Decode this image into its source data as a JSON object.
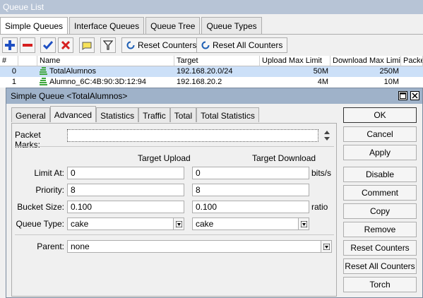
{
  "queue_list": {
    "title": "Queue List",
    "tabs": [
      "Simple Queues",
      "Interface Queues",
      "Queue Tree",
      "Queue Types"
    ],
    "toolbar": {
      "reset_counters": "Reset Counters",
      "reset_all_counters": "Reset All Counters"
    },
    "table": {
      "columns": [
        "#",
        "Name",
        "Target",
        "Upload Max Limit",
        "Download Max Limit",
        "Packe"
      ],
      "rows": [
        {
          "num": "0",
          "name": "TotalAlumnos",
          "target": "192.168.20.0/24",
          "upload": "50M",
          "download": "250M"
        },
        {
          "num": "1",
          "name": "Alumno_6C:4B:90:3D:12:94",
          "target": "192.168.20.2",
          "upload": "4M",
          "download": "10M"
        }
      ]
    }
  },
  "dialog": {
    "title": "Simple Queue <TotalAlumnos>",
    "tabs": [
      "General",
      "Advanced",
      "Statistics",
      "Traffic",
      "Total",
      "Total Statistics"
    ],
    "active_tab": "Advanced",
    "packet_marks_label": "Packet Marks:",
    "target_upload_label": "Target Upload",
    "target_download_label": "Target Download",
    "limit_at": {
      "label": "Limit At:",
      "upload": "0",
      "download": "0",
      "unit": "bits/s"
    },
    "priority": {
      "label": "Priority:",
      "upload": "8",
      "download": "8"
    },
    "bucket_size": {
      "label": "Bucket Size:",
      "upload": "0.100",
      "download": "0.100",
      "unit": "ratio"
    },
    "queue_type": {
      "label": "Queue Type:",
      "upload": "cake",
      "download": "cake"
    },
    "parent": {
      "label": "Parent:",
      "value": "none"
    },
    "buttons": [
      "OK",
      "Cancel",
      "Apply",
      "Disable",
      "Comment",
      "Copy",
      "Remove",
      "Reset Counters",
      "Reset All Counters",
      "Torch"
    ]
  },
  "colors": {
    "selected_row": "#cce0f8",
    "add_icon": "#1e4fc2",
    "remove_icon": "#d62020",
    "check_icon": "#1e4fc2",
    "cross_icon": "#d62020",
    "queue_icon": "#3da63d"
  }
}
